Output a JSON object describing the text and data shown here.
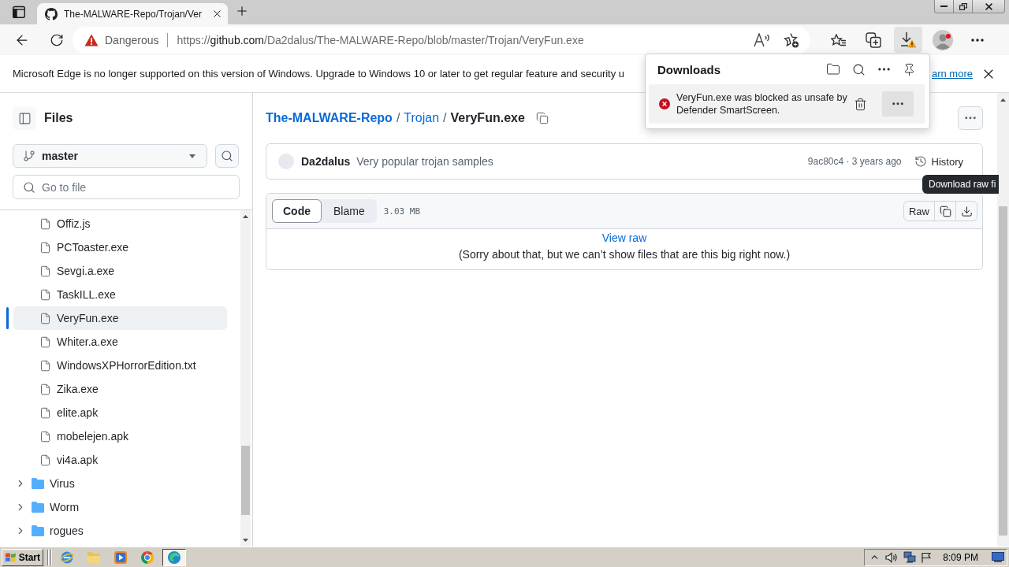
{
  "browser": {
    "tab": {
      "title": "The-MALWARE-Repo/Trojan/Ver",
      "selected": true
    },
    "address_bar": {
      "security_label": "Dangerous",
      "url": {
        "scheme": "https://",
        "host": "github.com",
        "path": "/Da2dalus/The-MALWARE-Repo/blob/master/Trojan/VeryFun.exe"
      }
    },
    "toolbar": {
      "downloads_active": true,
      "profile_badge": true
    }
  },
  "notification_bar": {
    "message": "Microsoft Edge is no longer supported on this version of Windows. Upgrade to Windows 10 or later to get regular feature and security u",
    "link": "arn more"
  },
  "downloads_panel": {
    "title": "Downloads",
    "items": [
      {
        "blocked": true,
        "message_lines": [
          "VeryFun.exe was blocked as unsafe by",
          "Defender SmartScreen."
        ]
      }
    ]
  },
  "sidebar": {
    "title": "Files",
    "branch": "master",
    "search": {
      "placeholder": "Go to file"
    },
    "tree": [
      {
        "kind": "continued",
        "children": [
          {
            "kind": "file",
            "label": "Offiz.js",
            "selected": false
          },
          {
            "kind": "file",
            "label": "PCToaster.exe",
            "selected": false
          },
          {
            "kind": "file",
            "label": "Sevgi.a.exe",
            "selected": false
          },
          {
            "kind": "file",
            "label": "TaskILL.exe",
            "selected": false
          },
          {
            "kind": "file",
            "label": "VeryFun.exe",
            "selected": true
          },
          {
            "kind": "file",
            "label": "Whiter.a.exe",
            "selected": false
          },
          {
            "kind": "file",
            "label": "WindowsXPHorrorEdition.txt",
            "selected": false
          },
          {
            "kind": "file",
            "label": "Zika.exe",
            "selected": false
          },
          {
            "kind": "file",
            "label": "elite.apk",
            "selected": false
          },
          {
            "kind": "file",
            "label": "mobelejen.apk",
            "selected": false
          },
          {
            "kind": "file",
            "label": "vi4a.apk",
            "selected": false
          }
        ]
      },
      {
        "kind": "folder",
        "label": "Virus",
        "expanded": false,
        "selected": false
      },
      {
        "kind": "folder",
        "label": "Worm",
        "expanded": false,
        "selected": false
      },
      {
        "kind": "folder",
        "label": "rogues",
        "expanded": false,
        "selected": false
      }
    ]
  },
  "breadcrumb": [
    {
      "kind": "root",
      "label": "The-MALWARE-Repo"
    },
    {
      "kind": "separator",
      "label": "/"
    },
    {
      "kind": "link",
      "label": "Trojan"
    },
    {
      "kind": "separator",
      "label": "/"
    },
    {
      "kind": "current",
      "label": "VeryFun.exe"
    }
  ],
  "commit": {
    "author": "Da2dalus",
    "message": "Very popular trojan samples",
    "meta": "9ac80c4 · 3 years ago",
    "history_label": "History"
  },
  "file_view": {
    "tabs": [
      {
        "label": "Code",
        "selected": true
      },
      {
        "label": "Blame",
        "selected": false
      }
    ],
    "size": "3.03 MB",
    "raw_label": "Raw",
    "tooltip": "Download raw fi",
    "view_raw": "View raw",
    "notice": "(Sorry about that, but we can’t show files that are this big right now.)"
  },
  "taskbar": {
    "start_label": "Start",
    "apps": [
      {
        "kind": "globe",
        "active": false
      },
      {
        "kind": "folder",
        "active": false
      },
      {
        "kind": "player",
        "active": false
      },
      {
        "kind": "ring",
        "active": false
      },
      {
        "kind": "wave",
        "active": true
      }
    ],
    "clock": "8:09 PM"
  }
}
